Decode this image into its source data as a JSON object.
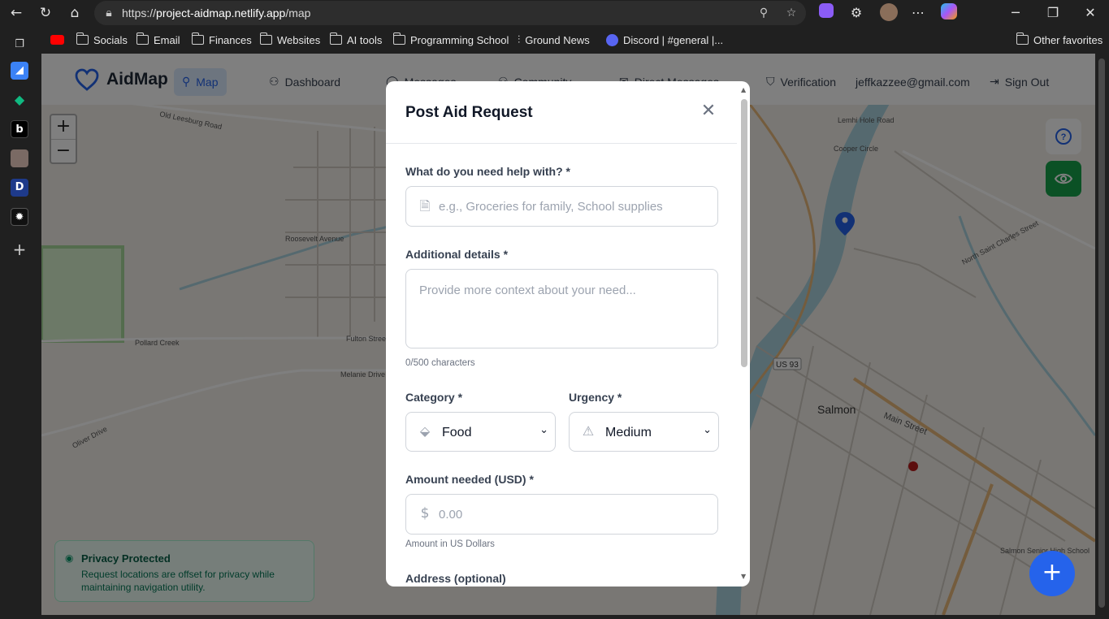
{
  "browser": {
    "url_prefix": "https://",
    "url_host": "project-aidmap.netlify.app",
    "url_path": "/map",
    "bookmarks": [
      {
        "label": "Socials"
      },
      {
        "label": "Email"
      },
      {
        "label": "Finances"
      },
      {
        "label": "Websites"
      },
      {
        "label": "AI tools"
      },
      {
        "label": "Programming School"
      },
      {
        "label": "Ground News"
      },
      {
        "label": "Discord | #general |..."
      },
      {
        "label": "Other favorites"
      }
    ]
  },
  "app": {
    "logo": "AidMap",
    "nav": {
      "map": "Map",
      "dashboard": "Dashboard",
      "messages": "Messages",
      "community": "Community",
      "direct_messages": "Direct Messages",
      "verification": "Verification",
      "user_email": "jeffkazzee@gmail.com",
      "sign_out": "Sign Out"
    }
  },
  "map": {
    "zoom_in": "+",
    "zoom_out": "−",
    "labels": {
      "old_leesburg": "Old Leesburg Road",
      "roosevelt": "Roosevelt Avenue",
      "pollard": "Pollard Creek",
      "fulton": "Fulton Street",
      "melanie": "Melanie Drive",
      "lemhi_hole": "Lemhi Hole Road",
      "cooper": "Cooper Circle",
      "salmon": "Salmon",
      "main": "Main Street",
      "us93": "US 93",
      "north_charles": "North Saint Charles Street",
      "oliver": "Oliver Drive",
      "salmon_hs": "Salmon Senior High School"
    }
  },
  "privacy": {
    "title": "Privacy Protected",
    "body": "Request locations are offset for privacy while maintaining navigation utility."
  },
  "modal": {
    "title": "Post Aid Request",
    "help_label": "What do you need help with? *",
    "help_placeholder": "e.g., Groceries for family, School supplies",
    "details_label": "Additional details *",
    "details_placeholder": "Provide more context about your need...",
    "char_count": "0/500 characters",
    "category_label": "Category *",
    "category_value": "Food",
    "urgency_label": "Urgency *",
    "urgency_value": "Medium",
    "amount_label": "Amount needed (USD) *",
    "amount_placeholder": "0.00",
    "amount_help": "Amount in US Dollars",
    "address_label": "Address (optional)"
  },
  "colors": {
    "brand": "#2563eb",
    "privacy_green": "#065f46",
    "visibility_green": "#16a34a"
  }
}
